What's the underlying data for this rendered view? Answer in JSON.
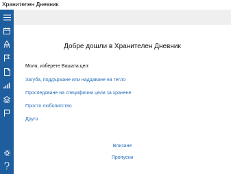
{
  "window": {
    "title": "Хранителен Дневник"
  },
  "sidebar": {
    "color": "#1f5e9e",
    "items": [
      {
        "icon": "menu-icon"
      },
      {
        "icon": "calendar-icon"
      },
      {
        "icon": "food-icon"
      },
      {
        "icon": "flag-icon"
      },
      {
        "icon": "document-icon"
      },
      {
        "icon": "chart-icon"
      },
      {
        "icon": "layers-icon"
      },
      {
        "icon": "goal-flag-icon"
      },
      {
        "icon": "gear-icon"
      },
      {
        "icon": "help-icon"
      }
    ]
  },
  "main": {
    "welcome": "Добре дошли в Хранителен Дневник",
    "prompt": "Моля, изберете Вашата цел:",
    "goals": [
      "Загуба, поддържане или наддаване на тегло",
      "Проследяване на специфични цели за хранене",
      "Просто любопитство",
      "Друго"
    ],
    "login": "Влизане",
    "skip": "Пропусни"
  },
  "colors": {
    "accent": "#2a6fb8",
    "topstrip": "#efefef"
  }
}
